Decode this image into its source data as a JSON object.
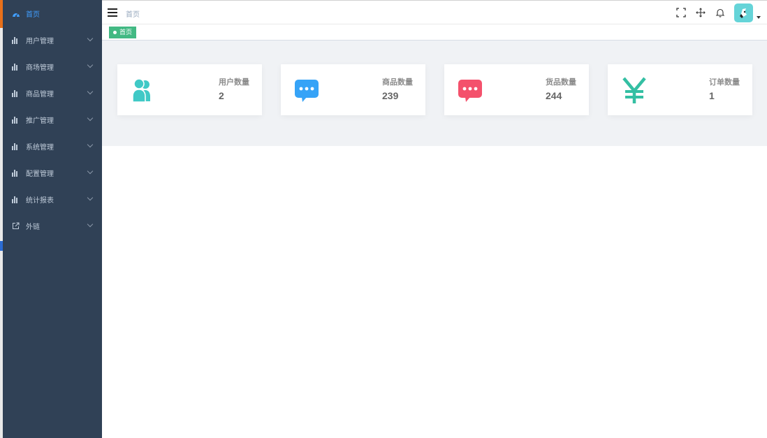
{
  "sidebar": {
    "items": [
      {
        "label": "首页",
        "icon": "dashboard-icon",
        "active": true
      },
      {
        "label": "用户管理",
        "icon": "chart-icon"
      },
      {
        "label": "商场管理",
        "icon": "chart-icon"
      },
      {
        "label": "商品管理",
        "icon": "chart-icon"
      },
      {
        "label": "推广管理",
        "icon": "chart-icon"
      },
      {
        "label": "系统管理",
        "icon": "chart-icon"
      },
      {
        "label": "配置管理",
        "icon": "chart-icon"
      },
      {
        "label": "统计报表",
        "icon": "chart-icon"
      },
      {
        "label": "外链",
        "icon": "external-link-icon"
      }
    ],
    "colors": {
      "background": "#304156",
      "text": "#bfcbd9",
      "active": "#409eff"
    }
  },
  "navbar": {
    "breadcrumb": "首页",
    "icons": [
      "fullscreen-icon",
      "move-icon",
      "bell-icon",
      "avatar"
    ]
  },
  "tags": {
    "active_tag": "首页",
    "color": "#42b983"
  },
  "panels": [
    {
      "label": "用户数量",
      "value": "2",
      "icon": "people-icon",
      "color": "#40c9c6"
    },
    {
      "label": "商品数量",
      "value": "239",
      "icon": "message-icon",
      "color": "#36a3f7"
    },
    {
      "label": "货品数量",
      "value": "244",
      "icon": "message-icon",
      "color": "#f4516c"
    },
    {
      "label": "订单数量",
      "value": "1",
      "icon": "yen-icon",
      "color": "#34bfa3"
    }
  ]
}
